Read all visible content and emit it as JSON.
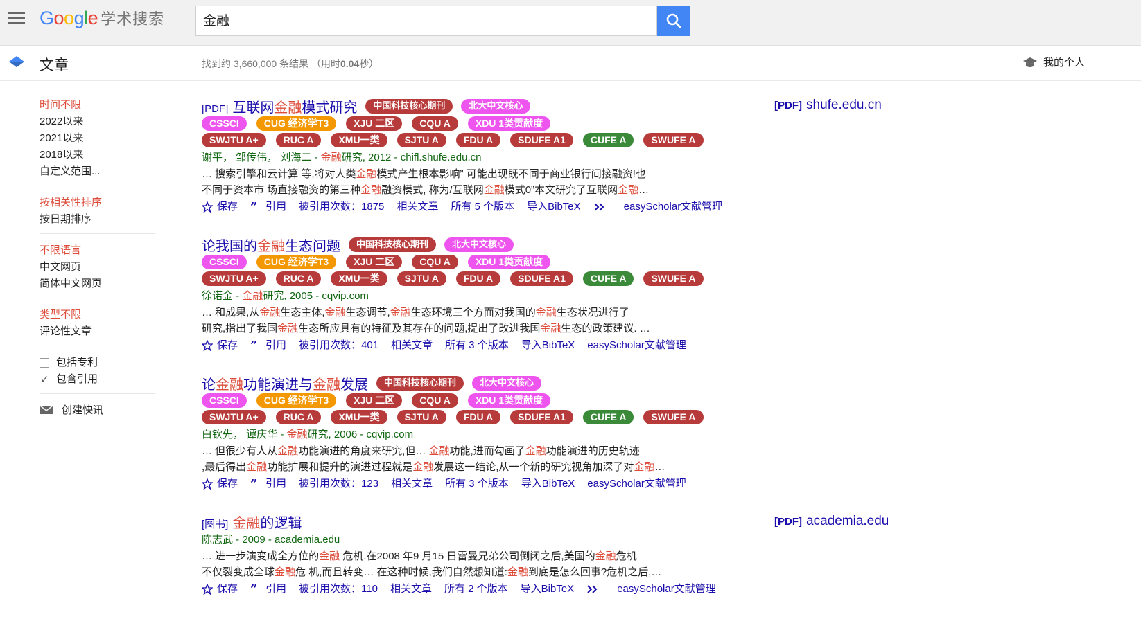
{
  "header": {
    "logo_text": "Google",
    "logo_sub": "学术搜索",
    "query": "金融"
  },
  "subbar": {
    "section_label": "文章",
    "results_prefix": "找到约 3,660,000 条结果 （用时",
    "results_time": "0.04",
    "results_suffix": "秒）",
    "profile_label": "我的个人"
  },
  "sidebar": {
    "time": [
      "时间不限",
      "2022以来",
      "2021以来",
      "2018以来",
      "自定义范围..."
    ],
    "sort": [
      "按相关性排序",
      "按日期排序"
    ],
    "lang": [
      "不限语言",
      "中文网页",
      "简体中文网页"
    ],
    "type": [
      "类型不限",
      "评论性文章"
    ],
    "include_patents": "包括专利",
    "include_citations": "包含引用",
    "create_alert": "创建快讯"
  },
  "results": [
    {
      "type_tag": "[PDF]",
      "title_a": "互联网",
      "title_hl": "金融",
      "title_b": "模式研究",
      "badges_title": [
        "中国科技核心期刊",
        "北大中文核心"
      ],
      "badges_row1": [
        "CSSCI",
        "CUG 经济学T3",
        "XJU 二区",
        "CQU A",
        "XDU 1类贡献度"
      ],
      "badges_row2": [
        "SWJTU A+",
        "RUC A",
        "XMU一类",
        "SJTU A",
        "FDU A",
        "SDUFE A1",
        "CUFE A",
        "SWUFE A"
      ],
      "authors_a": "谢平， 邹传伟， 刘海二 - ",
      "authors_hl": "金融",
      "authors_b": "研究, 2012 - chifl.shufe.edu.cn",
      "snippet1": [
        "… 搜索引擎和云计算 等,将对人类",
        "金融",
        "模式产生根本影响” 可能出现既不同于商业银行间接融资!也"
      ],
      "snippet2": [
        "不同于资本市 场直接融资的第三种",
        "金融",
        "融资模式, 称为/互联网",
        "金融",
        "模式0”本文研究了互联网",
        "金融",
        "…"
      ],
      "save": "保存",
      "cite": "引用",
      "cited_by": "被引用次数：1875",
      "related": "相关文章",
      "versions": "所有 5 个版本",
      "bibtex": "导入BibTeX",
      "easy": "easyScholar文献管理",
      "side_pdf": "[PDF]",
      "side_domain": "shufe.edu.cn"
    },
    {
      "title_a": "论我国的",
      "title_hl": "金融",
      "title_b": "生态问题",
      "badges_title": [
        "中国科技核心期刊",
        "北大中文核心"
      ],
      "badges_row1": [
        "CSSCI",
        "CUG 经济学T3",
        "XJU 二区",
        "CQU A",
        "XDU 1类贡献度"
      ],
      "badges_row2": [
        "SWJTU A+",
        "RUC A",
        "XMU一类",
        "SJTU A",
        "FDU A",
        "SDUFE A1",
        "CUFE A",
        "SWUFE A"
      ],
      "authors_a": "徐诺金 - ",
      "authors_hl": "金融",
      "authors_b": "研究, 2005 - cqvip.com",
      "snippet1": [
        "… 和成果,从",
        "金融",
        "生态主体,",
        "金融",
        "生态调节,",
        "金融",
        "生态环境三个方面对我国的",
        "金融",
        "生态状况进行了"
      ],
      "snippet2": [
        "研究,指出了我国",
        "金融",
        "生态所应具有的特征及其存在的问题,提出了改进我国",
        "金融",
        "生态的政策建议. …"
      ],
      "save": "保存",
      "cite": "引用",
      "cited_by": "被引用次数：401",
      "related": "相关文章",
      "versions": "所有 3 个版本",
      "bibtex": "导入BibTeX",
      "easy": "easyScholar文献管理"
    },
    {
      "title_a": "论",
      "title_hl": "金融",
      "title_b": "功能演进与",
      "title_hl2": "金融",
      "title_c": "发展",
      "badges_title": [
        "中国科技核心期刊",
        "北大中文核心"
      ],
      "badges_row1": [
        "CSSCI",
        "CUG 经济学T3",
        "XJU 二区",
        "CQU A",
        "XDU 1类贡献度"
      ],
      "badges_row2": [
        "SWJTU A+",
        "RUC A",
        "XMU一类",
        "SJTU A",
        "FDU A",
        "SDUFE A1",
        "CUFE A",
        "SWUFE A"
      ],
      "authors_a": "白钦先， 谭庆华 - ",
      "authors_hl": "金融",
      "authors_b": "研究, 2006 - cqvip.com",
      "snippet1": [
        "… 但很少有人从",
        "金融",
        "功能演进的角度来研究,但… ",
        "金融",
        "功能,进而勾画了",
        "金融",
        "功能演进的历史轨迹"
      ],
      "snippet2": [
        ",最后得出",
        "金融",
        "功能扩展和提升的演进过程就是",
        "金融",
        "发展这一结论,从一个新的研究视角加深了对",
        "金融",
        "…"
      ],
      "save": "保存",
      "cite": "引用",
      "cited_by": "被引用次数：123",
      "related": "相关文章",
      "versions": "所有 3 个版本",
      "bibtex": "导入BibTeX",
      "easy": "easyScholar文献管理"
    },
    {
      "type_tag": "[图书]",
      "title_hl": "金融",
      "title_b": "的逻辑",
      "authors_a": "陈志武 - 2009 - academia.edu",
      "snippet1": [
        "… 进一步演变成全方位的",
        "金融",
        " 危机.在2008 年9 月15 日雷曼兄弟公司倒闭之后,美国的",
        "金融",
        "危机"
      ],
      "snippet2": [
        "不仅裂变成全球",
        "金融",
        "危 机,而且转变… 在这种时候,我们自然想知道:",
        "金融",
        "到底是怎么回事?危机之后,…"
      ],
      "save": "保存",
      "cite": "引用",
      "cited_by": "被引用次数：110",
      "related": "相关文章",
      "versions": "所有 2 个版本",
      "bibtex": "导入BibTeX",
      "easy": "easyScholar文献管理",
      "side_pdf": "[PDF]",
      "side_domain": "academia.edu"
    }
  ],
  "colors": {
    "link": "#1a0dab",
    "highlight": "#dd4b39",
    "author_green": "#116611",
    "badge_red": "#b83b3b",
    "badge_pink": "#ee55ee",
    "badge_orange": "#f39800",
    "badge_green": "#3a8a3a",
    "search_blue": "#4285f4"
  }
}
